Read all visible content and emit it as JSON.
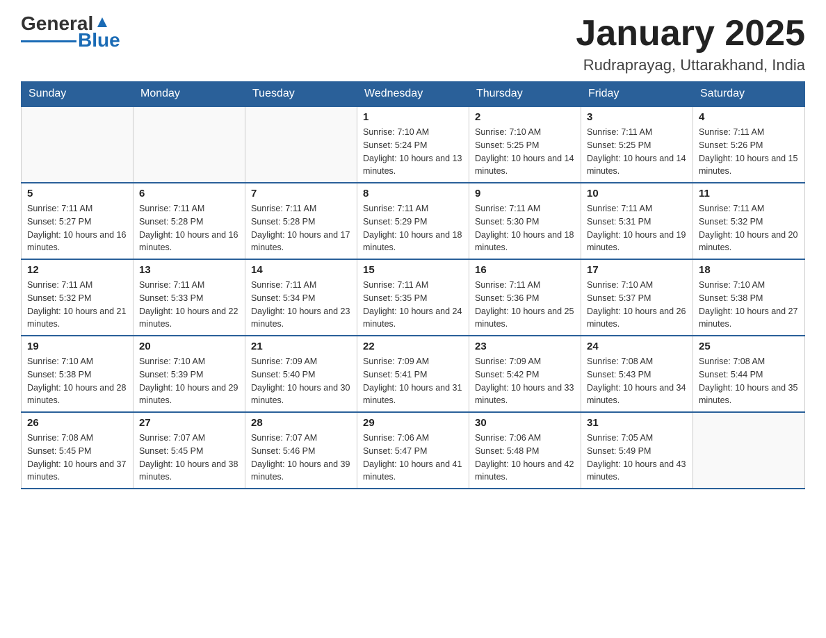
{
  "logo": {
    "text_general": "General",
    "text_blue": "Blue"
  },
  "title": "January 2025",
  "subtitle": "Rudraprayag, Uttarakhand, India",
  "weekdays": [
    "Sunday",
    "Monday",
    "Tuesday",
    "Wednesday",
    "Thursday",
    "Friday",
    "Saturday"
  ],
  "weeks": [
    [
      {
        "day": "",
        "sunrise": "",
        "sunset": "",
        "daylight": ""
      },
      {
        "day": "",
        "sunrise": "",
        "sunset": "",
        "daylight": ""
      },
      {
        "day": "",
        "sunrise": "",
        "sunset": "",
        "daylight": ""
      },
      {
        "day": "1",
        "sunrise": "Sunrise: 7:10 AM",
        "sunset": "Sunset: 5:24 PM",
        "daylight": "Daylight: 10 hours and 13 minutes."
      },
      {
        "day": "2",
        "sunrise": "Sunrise: 7:10 AM",
        "sunset": "Sunset: 5:25 PM",
        "daylight": "Daylight: 10 hours and 14 minutes."
      },
      {
        "day": "3",
        "sunrise": "Sunrise: 7:11 AM",
        "sunset": "Sunset: 5:25 PM",
        "daylight": "Daylight: 10 hours and 14 minutes."
      },
      {
        "day": "4",
        "sunrise": "Sunrise: 7:11 AM",
        "sunset": "Sunset: 5:26 PM",
        "daylight": "Daylight: 10 hours and 15 minutes."
      }
    ],
    [
      {
        "day": "5",
        "sunrise": "Sunrise: 7:11 AM",
        "sunset": "Sunset: 5:27 PM",
        "daylight": "Daylight: 10 hours and 16 minutes."
      },
      {
        "day": "6",
        "sunrise": "Sunrise: 7:11 AM",
        "sunset": "Sunset: 5:28 PM",
        "daylight": "Daylight: 10 hours and 16 minutes."
      },
      {
        "day": "7",
        "sunrise": "Sunrise: 7:11 AM",
        "sunset": "Sunset: 5:28 PM",
        "daylight": "Daylight: 10 hours and 17 minutes."
      },
      {
        "day": "8",
        "sunrise": "Sunrise: 7:11 AM",
        "sunset": "Sunset: 5:29 PM",
        "daylight": "Daylight: 10 hours and 18 minutes."
      },
      {
        "day": "9",
        "sunrise": "Sunrise: 7:11 AM",
        "sunset": "Sunset: 5:30 PM",
        "daylight": "Daylight: 10 hours and 18 minutes."
      },
      {
        "day": "10",
        "sunrise": "Sunrise: 7:11 AM",
        "sunset": "Sunset: 5:31 PM",
        "daylight": "Daylight: 10 hours and 19 minutes."
      },
      {
        "day": "11",
        "sunrise": "Sunrise: 7:11 AM",
        "sunset": "Sunset: 5:32 PM",
        "daylight": "Daylight: 10 hours and 20 minutes."
      }
    ],
    [
      {
        "day": "12",
        "sunrise": "Sunrise: 7:11 AM",
        "sunset": "Sunset: 5:32 PM",
        "daylight": "Daylight: 10 hours and 21 minutes."
      },
      {
        "day": "13",
        "sunrise": "Sunrise: 7:11 AM",
        "sunset": "Sunset: 5:33 PM",
        "daylight": "Daylight: 10 hours and 22 minutes."
      },
      {
        "day": "14",
        "sunrise": "Sunrise: 7:11 AM",
        "sunset": "Sunset: 5:34 PM",
        "daylight": "Daylight: 10 hours and 23 minutes."
      },
      {
        "day": "15",
        "sunrise": "Sunrise: 7:11 AM",
        "sunset": "Sunset: 5:35 PM",
        "daylight": "Daylight: 10 hours and 24 minutes."
      },
      {
        "day": "16",
        "sunrise": "Sunrise: 7:11 AM",
        "sunset": "Sunset: 5:36 PM",
        "daylight": "Daylight: 10 hours and 25 minutes."
      },
      {
        "day": "17",
        "sunrise": "Sunrise: 7:10 AM",
        "sunset": "Sunset: 5:37 PM",
        "daylight": "Daylight: 10 hours and 26 minutes."
      },
      {
        "day": "18",
        "sunrise": "Sunrise: 7:10 AM",
        "sunset": "Sunset: 5:38 PM",
        "daylight": "Daylight: 10 hours and 27 minutes."
      }
    ],
    [
      {
        "day": "19",
        "sunrise": "Sunrise: 7:10 AM",
        "sunset": "Sunset: 5:38 PM",
        "daylight": "Daylight: 10 hours and 28 minutes."
      },
      {
        "day": "20",
        "sunrise": "Sunrise: 7:10 AM",
        "sunset": "Sunset: 5:39 PM",
        "daylight": "Daylight: 10 hours and 29 minutes."
      },
      {
        "day": "21",
        "sunrise": "Sunrise: 7:09 AM",
        "sunset": "Sunset: 5:40 PM",
        "daylight": "Daylight: 10 hours and 30 minutes."
      },
      {
        "day": "22",
        "sunrise": "Sunrise: 7:09 AM",
        "sunset": "Sunset: 5:41 PM",
        "daylight": "Daylight: 10 hours and 31 minutes."
      },
      {
        "day": "23",
        "sunrise": "Sunrise: 7:09 AM",
        "sunset": "Sunset: 5:42 PM",
        "daylight": "Daylight: 10 hours and 33 minutes."
      },
      {
        "day": "24",
        "sunrise": "Sunrise: 7:08 AM",
        "sunset": "Sunset: 5:43 PM",
        "daylight": "Daylight: 10 hours and 34 minutes."
      },
      {
        "day": "25",
        "sunrise": "Sunrise: 7:08 AM",
        "sunset": "Sunset: 5:44 PM",
        "daylight": "Daylight: 10 hours and 35 minutes."
      }
    ],
    [
      {
        "day": "26",
        "sunrise": "Sunrise: 7:08 AM",
        "sunset": "Sunset: 5:45 PM",
        "daylight": "Daylight: 10 hours and 37 minutes."
      },
      {
        "day": "27",
        "sunrise": "Sunrise: 7:07 AM",
        "sunset": "Sunset: 5:45 PM",
        "daylight": "Daylight: 10 hours and 38 minutes."
      },
      {
        "day": "28",
        "sunrise": "Sunrise: 7:07 AM",
        "sunset": "Sunset: 5:46 PM",
        "daylight": "Daylight: 10 hours and 39 minutes."
      },
      {
        "day": "29",
        "sunrise": "Sunrise: 7:06 AM",
        "sunset": "Sunset: 5:47 PM",
        "daylight": "Daylight: 10 hours and 41 minutes."
      },
      {
        "day": "30",
        "sunrise": "Sunrise: 7:06 AM",
        "sunset": "Sunset: 5:48 PM",
        "daylight": "Daylight: 10 hours and 42 minutes."
      },
      {
        "day": "31",
        "sunrise": "Sunrise: 7:05 AM",
        "sunset": "Sunset: 5:49 PM",
        "daylight": "Daylight: 10 hours and 43 minutes."
      },
      {
        "day": "",
        "sunrise": "",
        "sunset": "",
        "daylight": ""
      }
    ]
  ]
}
